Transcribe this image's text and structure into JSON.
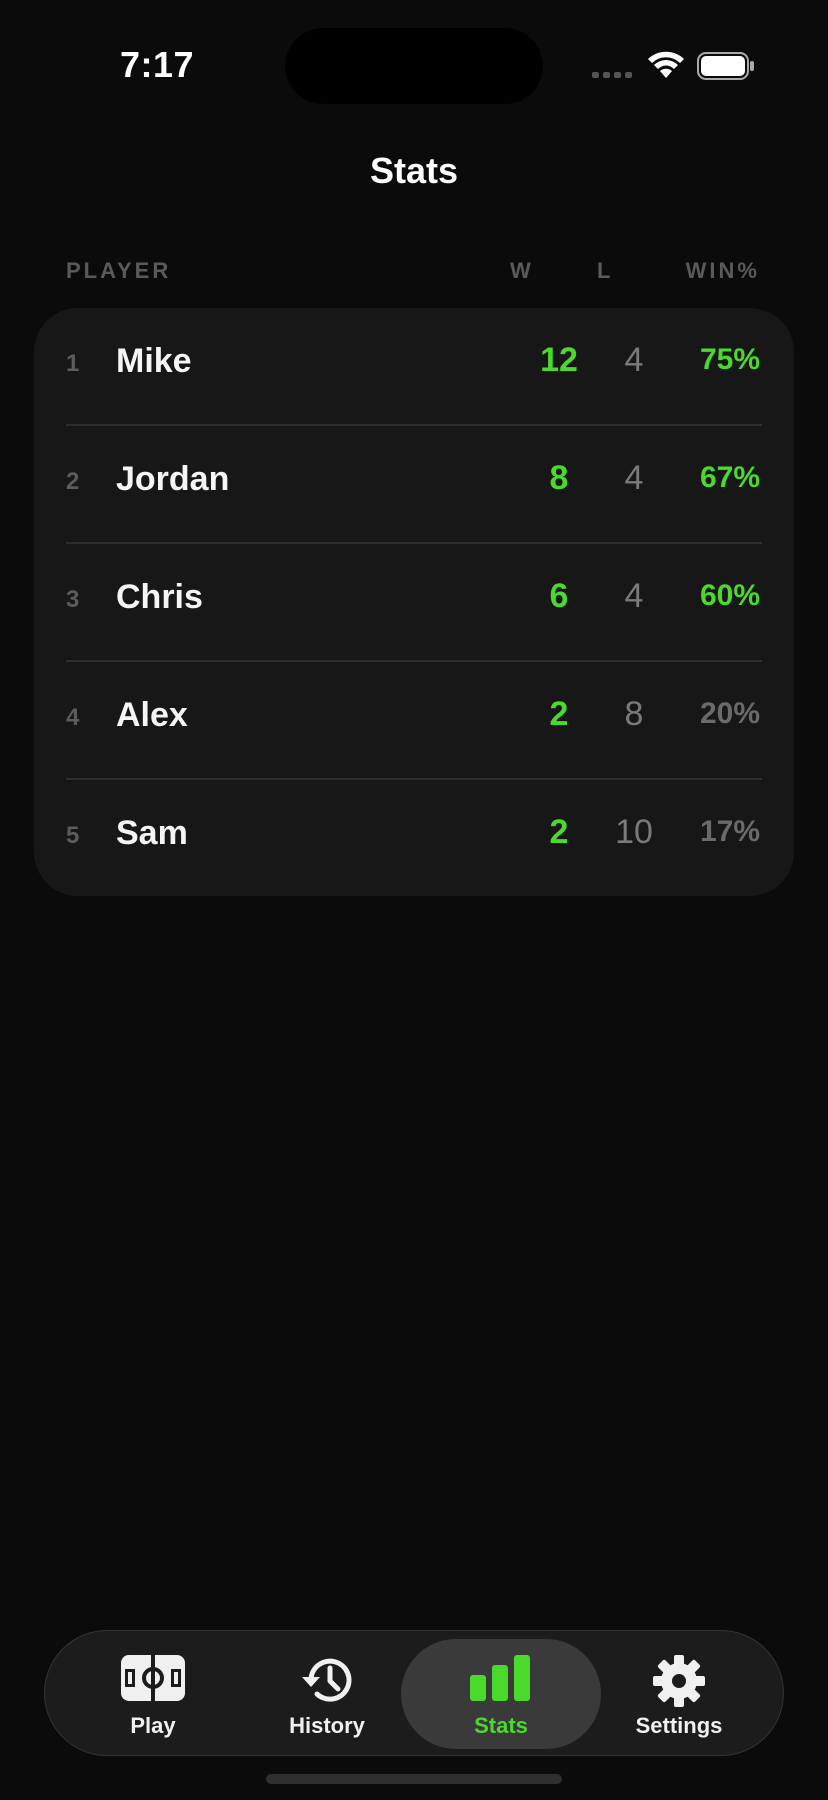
{
  "status": {
    "time": "7:17"
  },
  "page": {
    "title": "Stats"
  },
  "columns": {
    "player": "PLAYER",
    "wins": "W",
    "losses": "L",
    "win_pct": "WIN%"
  },
  "players": [
    {
      "rank": "1",
      "name": "Mike",
      "wins": "12",
      "losses": "4",
      "win_pct": "75%",
      "highlight": true
    },
    {
      "rank": "2",
      "name": "Jordan",
      "wins": "8",
      "losses": "4",
      "win_pct": "67%",
      "highlight": true
    },
    {
      "rank": "3",
      "name": "Chris",
      "wins": "6",
      "losses": "4",
      "win_pct": "60%",
      "highlight": true
    },
    {
      "rank": "4",
      "name": "Alex",
      "wins": "2",
      "losses": "8",
      "win_pct": "20%",
      "highlight": false
    },
    {
      "rank": "5",
      "name": "Sam",
      "wins": "2",
      "losses": "10",
      "win_pct": "17%",
      "highlight": false
    }
  ],
  "tabs": [
    {
      "label": "Play",
      "icon": "court-icon",
      "active": false
    },
    {
      "label": "History",
      "icon": "history-icon",
      "active": false
    },
    {
      "label": "Stats",
      "icon": "bar-chart-icon",
      "active": true
    },
    {
      "label": "Settings",
      "icon": "gear-icon",
      "active": false
    }
  ],
  "colors": {
    "accent": "#4bd92c",
    "background": "#0b0b0b",
    "card": "#171717"
  }
}
